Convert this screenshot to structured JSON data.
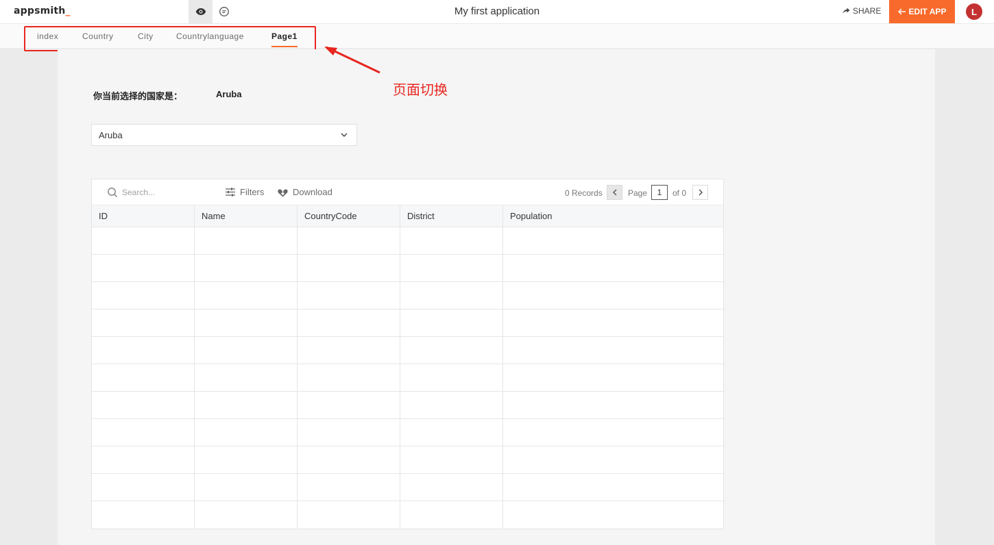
{
  "header": {
    "logo_text": "appsmith",
    "logo_suffix": "_",
    "app_title": "My first application",
    "share_label": "SHARE",
    "edit_label": "EDIT APP",
    "avatar_initial": "L",
    "brand_color": "#f86a2b",
    "icons": {
      "view": "eye-icon",
      "comment": "comment-icon",
      "share": "share-arrow-icon",
      "edit": "arrow-left-icon"
    }
  },
  "tabs": [
    {
      "label": "index",
      "active": false
    },
    {
      "label": "Country",
      "active": false
    },
    {
      "label": "City",
      "active": false
    },
    {
      "label": "Countrylanguage",
      "active": false
    },
    {
      "label": "Page1",
      "active": true
    }
  ],
  "content": {
    "selected_label": "你当前选择的国家是：",
    "selected_value": "Aruba",
    "dropdown_value": "Aruba"
  },
  "table": {
    "search_placeholder": "Search...",
    "filters_label": "Filters",
    "download_label": "Download",
    "records_text": "0 Records",
    "page_label": "Page",
    "page_number": "1",
    "page_of": "of 0",
    "columns": [
      "ID",
      "Name",
      "CountryCode",
      "District",
      "Population"
    ],
    "rows": []
  },
  "annotation": {
    "text": "页面切换",
    "color": "#e8261f"
  }
}
